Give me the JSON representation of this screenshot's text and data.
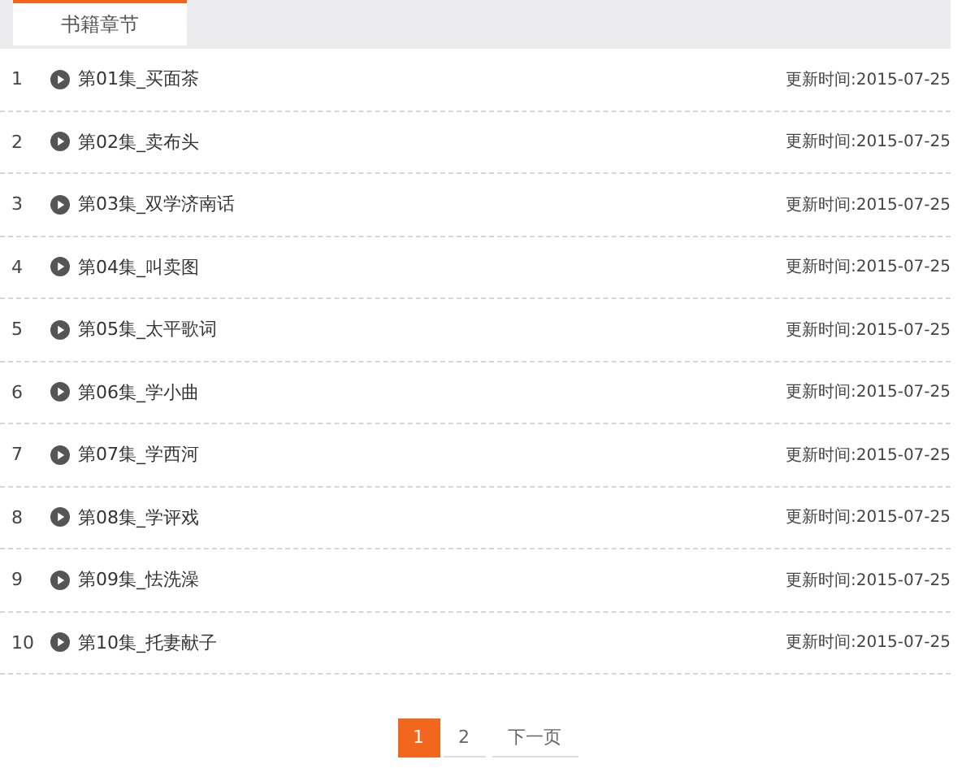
{
  "tabs": [
    {
      "label": "书籍章节",
      "selected": true
    }
  ],
  "chapters": [
    {
      "index": "1",
      "title": "第01集_买面茶",
      "updated": "更新时间:2015-07-25"
    },
    {
      "index": "2",
      "title": "第02集_卖布头",
      "updated": "更新时间:2015-07-25"
    },
    {
      "index": "3",
      "title": "第03集_双学济南话",
      "updated": "更新时间:2015-07-25"
    },
    {
      "index": "4",
      "title": "第04集_叫卖图",
      "updated": "更新时间:2015-07-25"
    },
    {
      "index": "5",
      "title": "第05集_太平歌词",
      "updated": "更新时间:2015-07-25"
    },
    {
      "index": "6",
      "title": "第06集_学小曲",
      "updated": "更新时间:2015-07-25"
    },
    {
      "index": "7",
      "title": "第07集_学西河",
      "updated": "更新时间:2015-07-25"
    },
    {
      "index": "8",
      "title": "第08集_学评戏",
      "updated": "更新时间:2015-07-25"
    },
    {
      "index": "9",
      "title": "第09集_怯洗澡",
      "updated": "更新时间:2015-07-25"
    },
    {
      "index": "10",
      "title": "第10集_托妻献子",
      "updated": "更新时间:2015-07-25"
    }
  ],
  "pagination": [
    {
      "label": "1",
      "selected": true
    },
    {
      "label": "2",
      "selected": false
    },
    {
      "label": "下一页",
      "selected": false
    }
  ]
}
